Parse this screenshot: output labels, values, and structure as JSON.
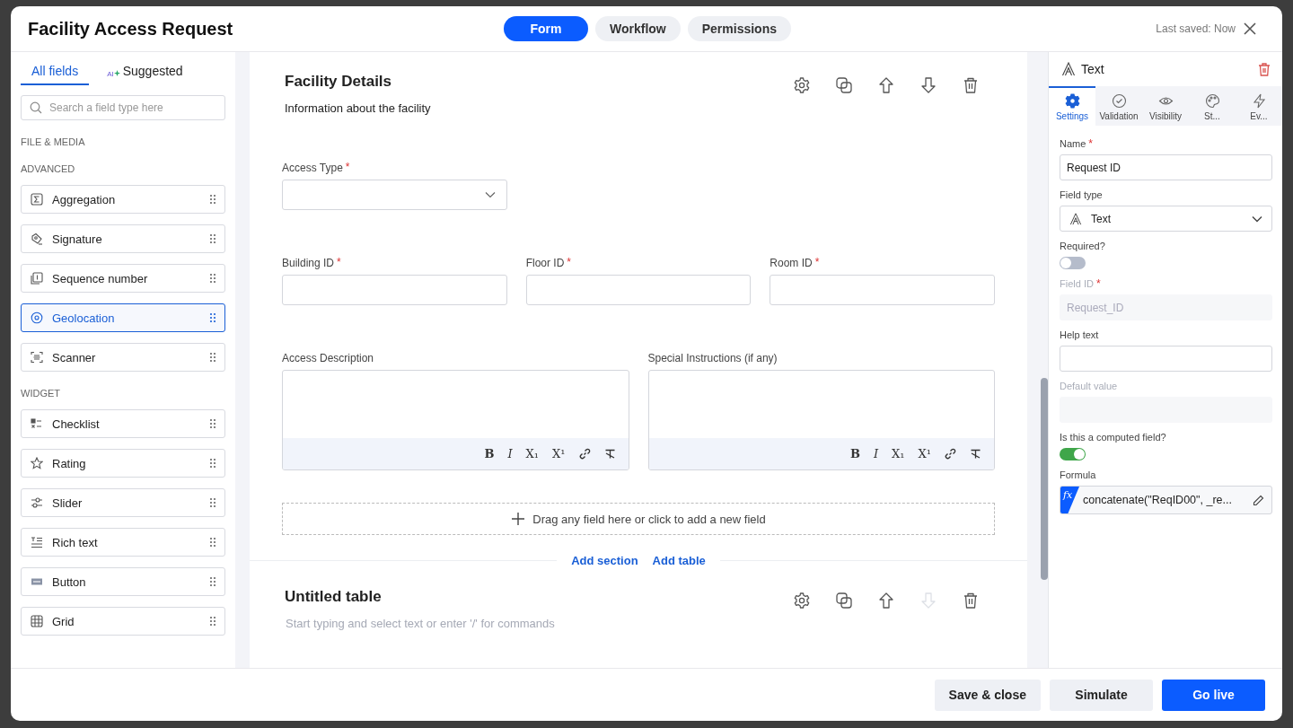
{
  "window": {
    "title": "Facility Access Request",
    "last_saved": "Last saved: Now"
  },
  "mode_tabs": [
    {
      "label": "Form",
      "selected": true
    },
    {
      "label": "Workflow",
      "selected": false
    },
    {
      "label": "Permissions",
      "selected": false
    }
  ],
  "sidebar": {
    "tabs": [
      {
        "label": "All fields",
        "selected": true,
        "kind": "plain"
      },
      {
        "label": "Suggested",
        "selected": false,
        "kind": "ai",
        "badge": "AI"
      }
    ],
    "search": {
      "placeholder": "Search a field type here"
    },
    "groups": [
      {
        "heading": "FILE & MEDIA"
      },
      {
        "heading": "ADVANCED",
        "items": [
          {
            "label": "Aggregation",
            "kind": "sigma",
            "selected": false
          },
          {
            "label": "Signature",
            "kind": "signature",
            "selected": false
          },
          {
            "label": "Sequence number",
            "kind": "sequence",
            "selected": false
          },
          {
            "label": "Geolocation",
            "kind": "location",
            "selected": true
          },
          {
            "label": "Scanner",
            "kind": "scanner",
            "selected": false
          }
        ]
      },
      {
        "heading": "WIDGET",
        "items": [
          {
            "label": "Checklist",
            "kind": "checklist",
            "selected": false
          },
          {
            "label": "Rating",
            "kind": "star",
            "selected": false
          },
          {
            "label": "Slider",
            "kind": "slider",
            "selected": false
          },
          {
            "label": "Rich text",
            "kind": "richtext",
            "selected": false
          },
          {
            "label": "Button",
            "kind": "button",
            "selected": false
          },
          {
            "label": "Grid",
            "kind": "grid",
            "selected": false
          }
        ]
      }
    ]
  },
  "sections": [
    {
      "kind": "section",
      "title": "Facility Details",
      "description": "Information about the facility",
      "actions": [
        {
          "kind": "gear",
          "disabled": false
        },
        {
          "kind": "copy",
          "disabled": false
        },
        {
          "kind": "up",
          "disabled": false
        },
        {
          "kind": "down",
          "disabled": false
        },
        {
          "kind": "trash",
          "disabled": false
        }
      ],
      "rows": [
        {
          "fields": [
            {
              "label": "Access Type",
              "required_mark": "*",
              "kind": "select"
            }
          ]
        },
        {
          "fields": [
            {
              "label": "Building ID",
              "required_mark": "*",
              "kind": "text"
            },
            {
              "label": "Floor ID",
              "required_mark": "*",
              "kind": "text"
            },
            {
              "label": "Room ID",
              "required_mark": "*",
              "kind": "text"
            }
          ]
        },
        {
          "fields": [
            {
              "label": "Access Description",
              "kind": "richtext",
              "toolbar": [
                {
                  "kind": "bold",
                  "label": "B"
                },
                {
                  "kind": "italic",
                  "label": "I"
                },
                {
                  "kind": "sub",
                  "label": "X₁"
                },
                {
                  "kind": "sup",
                  "label": "X¹"
                },
                {
                  "kind": "link"
                },
                {
                  "kind": "clear"
                }
              ]
            },
            {
              "label": "Special Instructions (if any)",
              "kind": "richtext",
              "toolbar": [
                {
                  "kind": "bold",
                  "label": "B"
                },
                {
                  "kind": "italic",
                  "label": "I"
                },
                {
                  "kind": "sub",
                  "label": "X₁"
                },
                {
                  "kind": "sup",
                  "label": "X¹"
                },
                {
                  "kind": "link"
                },
                {
                  "kind": "clear"
                }
              ]
            }
          ]
        }
      ],
      "drop_zone": "Drag any field here or click to add a new field"
    },
    {
      "kind": "table",
      "title": "Untitled table",
      "placeholder": "Start typing and select text or enter '/' for commands",
      "actions": [
        {
          "kind": "gear",
          "disabled": false
        },
        {
          "kind": "copy",
          "disabled": false
        },
        {
          "kind": "up",
          "disabled": false
        },
        {
          "kind": "down",
          "disabled": true
        },
        {
          "kind": "trash",
          "disabled": false
        }
      ]
    }
  ],
  "add_links": [
    "Add section",
    "Add table"
  ],
  "properties": {
    "title": "Text",
    "tabs": [
      {
        "label": "Settings",
        "kind": "settings",
        "selected": true
      },
      {
        "label": "Validation",
        "kind": "validation",
        "selected": false
      },
      {
        "label": "Visibility",
        "kind": "visibility",
        "selected": false
      },
      {
        "label": "St...",
        "kind": "style",
        "selected": false
      },
      {
        "label": "Ev...",
        "kind": "events",
        "selected": false
      }
    ],
    "fields": [
      {
        "kind": "input",
        "label": "Name",
        "required_mark": "*",
        "disabled": false,
        "value": "Request ID"
      },
      {
        "kind": "select",
        "label": "Field type",
        "disabled": false,
        "value": "Text"
      },
      {
        "kind": "toggle",
        "label": "Required?",
        "disabled": false,
        "on": false
      },
      {
        "kind": "input",
        "label": "Field ID",
        "required_mark": "*",
        "disabled": true,
        "value": "Request_ID"
      },
      {
        "kind": "input",
        "label": "Help text",
        "disabled": false
      },
      {
        "kind": "input",
        "label": "Default value",
        "disabled": true
      },
      {
        "kind": "toggle",
        "label": "Is this a computed field?",
        "disabled": false,
        "on": true
      },
      {
        "kind": "formula",
        "label": "Formula",
        "disabled": false,
        "badge": "fx",
        "value": "concatenate(\"ReqID00\", _re..."
      }
    ]
  },
  "footer_buttons": [
    {
      "label": "Save & close",
      "kind": "secondary"
    },
    {
      "label": "Simulate",
      "kind": "secondary"
    },
    {
      "label": "Go live",
      "kind": "primary"
    }
  ]
}
